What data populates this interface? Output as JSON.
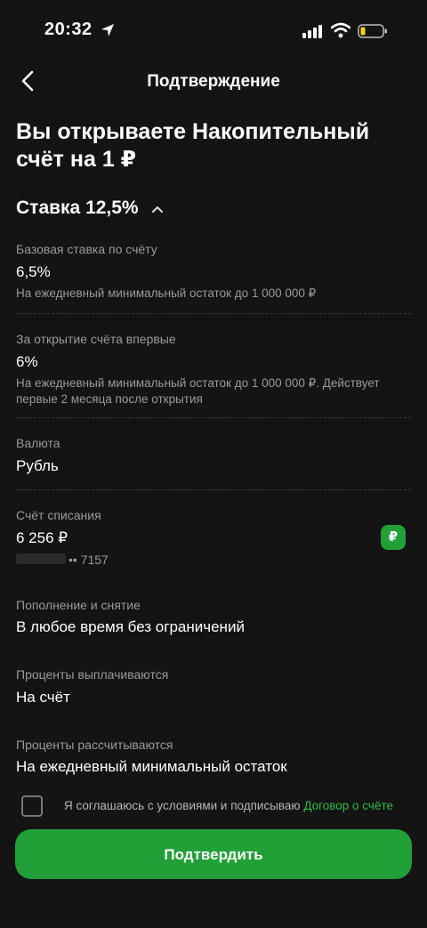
{
  "status_bar": {
    "time": "20:32"
  },
  "nav": {
    "title": "Подтверждение"
  },
  "heading": "Вы открываете Накопительный счёт на 1 ₽",
  "rate": {
    "title": "Ставка 12,5%"
  },
  "items": [
    {
      "label": "Базовая ставка по счёту",
      "value": "6,5%",
      "hint": "На ежедневный минимальный остаток до 1 000 000 ₽"
    },
    {
      "label": "За открытие счёта впервые",
      "value": "6%",
      "hint": "На ежедневный минимальный остаток до 1 000 000 ₽. Действует первые 2 месяца после открытия"
    }
  ],
  "currency": {
    "label": "Валюта",
    "value": "Рубль"
  },
  "debit_account": {
    "label": "Счёт списания",
    "amount": "6 256 ₽",
    "mask": "•• 7157",
    "badge": "₽"
  },
  "topup": {
    "label": "Пополнение и снятие",
    "value": "В любое время без ограничений"
  },
  "interest_paid": {
    "label": "Проценты выплачиваются",
    "value": "На счёт"
  },
  "interest_calc": {
    "label": "Проценты рассчитываются",
    "value": "На ежедневный минимальный остаток"
  },
  "consent": {
    "text": "Я соглашаюсь с условиями и подписываю",
    "link": "Договор о счёте"
  },
  "confirm_button": "Подтвердить",
  "colors": {
    "accent": "#21a038",
    "link": "#2fbb4a",
    "background": "#141414"
  }
}
